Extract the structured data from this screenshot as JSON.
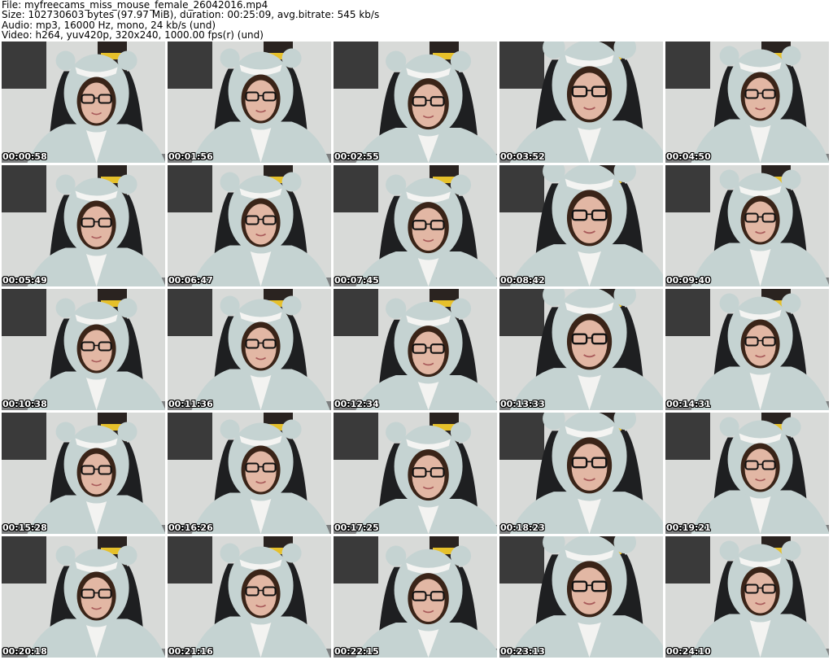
{
  "header": {
    "file": "File: myfreecams_miss_mouse_female_26042016.mp4",
    "size": "Size: 102730603 bytes (97.97 MiB), duration: 00:25:09, avg.bitrate: 545 kb/s",
    "audio": "Audio: mp3, 16000 Hz, mono, 24 kb/s (und)",
    "video": "Video: h264, yuv420p, 320x240, 1000.00 fps(r) (und)"
  },
  "thumbnails": [
    {
      "timestamp": "00:00:58"
    },
    {
      "timestamp": "00:01:56"
    },
    {
      "timestamp": "00:02:55"
    },
    {
      "timestamp": "00:03:52"
    },
    {
      "timestamp": "00:04:50"
    },
    {
      "timestamp": "00:05:49"
    },
    {
      "timestamp": "00:06:47"
    },
    {
      "timestamp": "00:07:45"
    },
    {
      "timestamp": "00:08:42"
    },
    {
      "timestamp": "00:09:40"
    },
    {
      "timestamp": "00:10:38"
    },
    {
      "timestamp": "00:11:36"
    },
    {
      "timestamp": "00:12:34"
    },
    {
      "timestamp": "00:13:33"
    },
    {
      "timestamp": "00:14:31"
    },
    {
      "timestamp": "00:15:28"
    },
    {
      "timestamp": "00:16:26"
    },
    {
      "timestamp": "00:17:25"
    },
    {
      "timestamp": "00:18:23"
    },
    {
      "timestamp": "00:19:21"
    },
    {
      "timestamp": "00:20:18"
    },
    {
      "timestamp": "00:21:16"
    },
    {
      "timestamp": "00:22:15"
    },
    {
      "timestamp": "00:23:13"
    },
    {
      "timestamp": "00:24:10"
    }
  ],
  "colors": {
    "background": "#ffffff",
    "hood": "#c5d3d2",
    "wall": "#d8dad8",
    "chair": "#1e1f21",
    "poster": "#2a2320"
  }
}
